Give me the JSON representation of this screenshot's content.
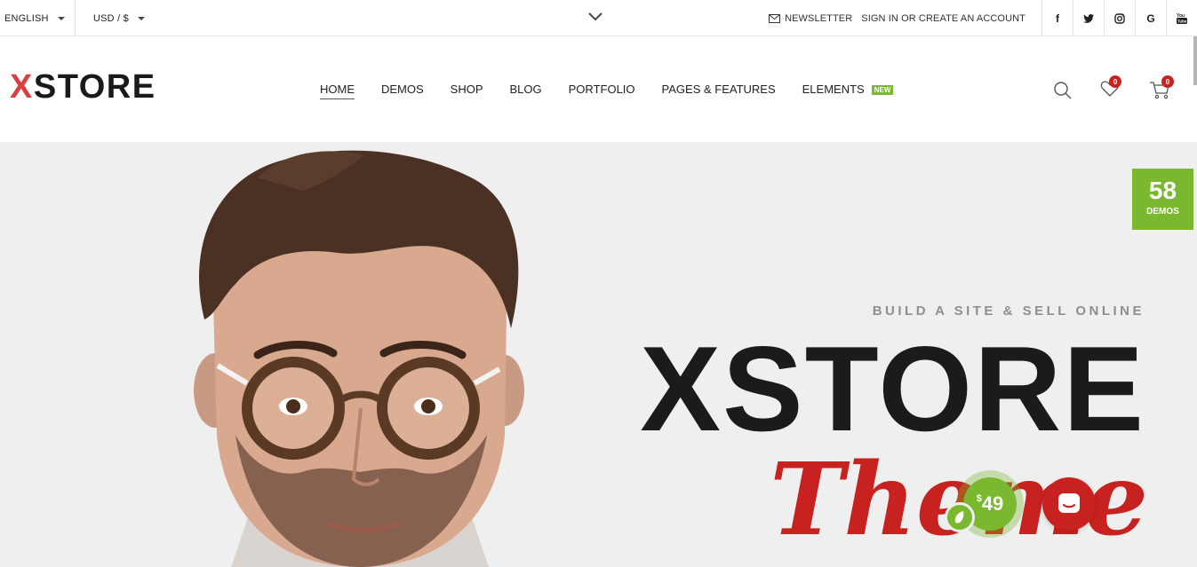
{
  "topbar": {
    "language": "ENGLISH",
    "currency": "USD / $",
    "newsletter": "NEWSLETTER",
    "account": "SIGN IN OR CREATE AN ACCOUNT",
    "social": [
      "f",
      "t",
      "i",
      "G",
      "yt"
    ]
  },
  "header": {
    "logo_x": "X",
    "logo_rest": "STORE",
    "nav": [
      "HOME",
      "DEMOS",
      "SHOP",
      "BLOG",
      "PORTFOLIO",
      "PAGES & FEATURES",
      "ELEMENTS"
    ],
    "new_badge": "NEW",
    "wishlist_count": "0",
    "cart_count": "0",
    "icons": [
      "search-icon",
      "heart-icon",
      "cart-icon"
    ]
  },
  "hero": {
    "tagline": "BUILD A SITE & SELL ONLINE",
    "title": "XSTORE",
    "script": "Theme"
  },
  "demos": {
    "count": "58",
    "label": "DEMOS"
  },
  "price": {
    "currency": "$",
    "amount": "49"
  },
  "colors": {
    "accent_red": "#c7221f",
    "accent_green": "#7ab82f",
    "hero_bg": "#efefef"
  }
}
